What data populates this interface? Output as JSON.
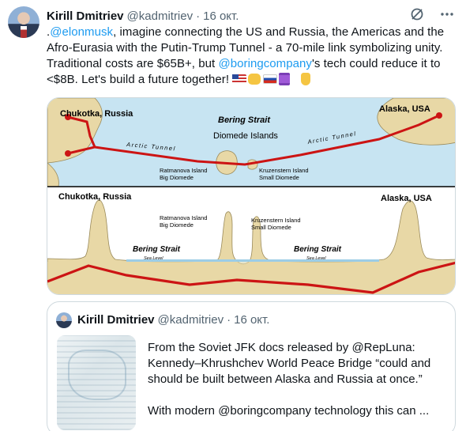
{
  "tweet": {
    "author_name": "Kirill Dmitriev",
    "author_handle": "@kadmitriev",
    "separator": "·",
    "timestamp": "16 окт.",
    "text_prefix": ".",
    "mention_1": "@elonmusk",
    "text_part_1": ", imagine connecting the US and Russia, the Americas and the Afro-Eurasia with the Putin-Trump Tunnel - a 70-mile link symbolizing unity. Traditional costs are $65B+, but ",
    "mention_2": "@boringcompany",
    "text_part_2": "'s tech could reduce it to <$8B. Let's build a future together! ",
    "emoji_sequence": [
      "us-flag",
      "handshake",
      "russia-flag",
      "thread-spool",
      "point-down"
    ]
  },
  "header_icons": [
    "grok-icon",
    "more-icon"
  ],
  "map": {
    "top_left_region": "Chukotka, Russia",
    "top_right_region": "Alaska, USA",
    "strait": "Bering Strait",
    "islands": "Diomede Islands",
    "tunnel_label": "Arctic Tunnel",
    "island_1_name": "Ratmanova Island",
    "island_1_alt": "Big Diomede",
    "island_2_name": "Kruzenstern Island",
    "island_2_alt": "Small Diomede",
    "sea_level": "Sea Level",
    "colors": {
      "sea": "#c7e4f2",
      "land": "#e8d8a6",
      "tunnel": "#cc1414",
      "frame": "#000000"
    }
  },
  "quote": {
    "author_name": "Kirill Dmitriev",
    "author_handle": "@kadmitriev",
    "separator": "·",
    "timestamp": "16 окт.",
    "paragraph_1": "From the Soviet JFK docs released by @RepLuna: Kennedy–Khrushchev World Peace Bridge “could and should be built between Alaska and Russia at once.”",
    "paragraph_2": "With modern @boringcompany technology this can ..."
  }
}
